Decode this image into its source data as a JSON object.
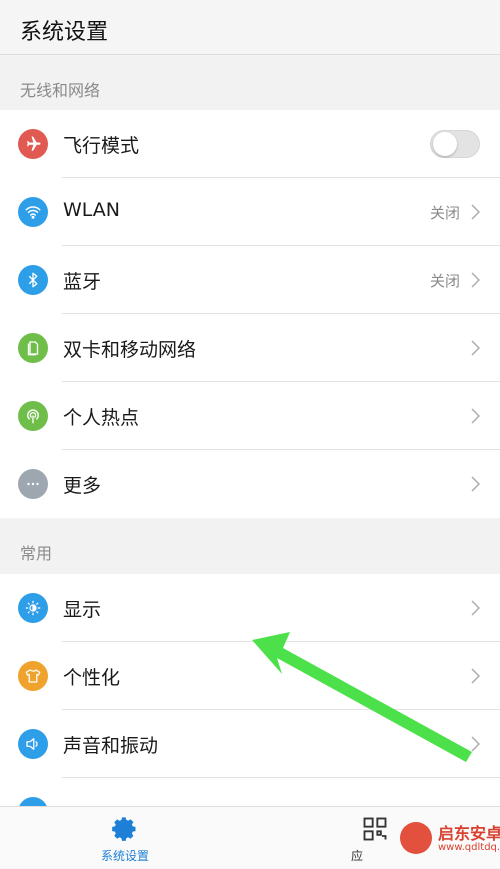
{
  "header": {
    "title": "系统设置"
  },
  "sections": [
    {
      "title": "无线和网络",
      "items": [
        {
          "label": "飞行模式",
          "icon": "airplane-icon",
          "color": "#e05a52",
          "control": "toggle",
          "toggle_on": false
        },
        {
          "label": "WLAN",
          "icon": "wifi-icon",
          "color": "#2f9ee8",
          "value": "关闭"
        },
        {
          "label": "蓝牙",
          "icon": "bluetooth-icon",
          "color": "#2f9ee8",
          "value": "关闭"
        },
        {
          "label": "双卡和移动网络",
          "icon": "sim-card-icon",
          "color": "#6fbe4a"
        },
        {
          "label": "个人热点",
          "icon": "hotspot-icon",
          "color": "#6fbe4a"
        },
        {
          "label": "更多",
          "icon": "more-icon",
          "color": "#9ea7b0"
        }
      ]
    },
    {
      "title": "常用",
      "items": [
        {
          "label": "显示",
          "icon": "brightness-icon",
          "color": "#2f9ee8"
        },
        {
          "label": "个性化",
          "icon": "tshirt-icon",
          "color": "#f0a32c"
        },
        {
          "label": "声音和振动",
          "icon": "speaker-icon",
          "color": "#2f9ee8"
        }
      ]
    }
  ],
  "bottom_nav": {
    "tabs": [
      {
        "label": "系统设置",
        "icon": "gear-icon",
        "active": true,
        "color": "#1e7fd6"
      },
      {
        "label": "应",
        "icon": "apps-grid-icon",
        "active": false,
        "color": "#333333"
      }
    ]
  },
  "watermark": {
    "title": "启东安卓网",
    "subtitle": "www.qdltdq.com"
  },
  "annotation": {
    "arrow_color": "#4ce14a"
  }
}
